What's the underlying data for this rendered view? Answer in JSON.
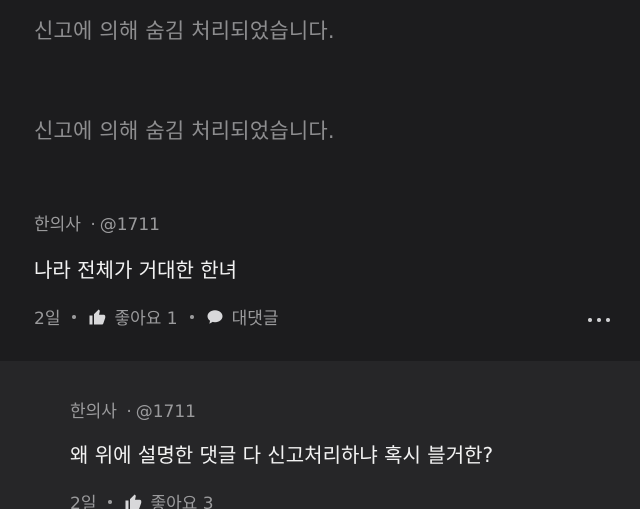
{
  "hidden_notices": [
    "신고에 의해 숨김 처리되었습니다.",
    "신고에 의해 숨김 처리되었습니다."
  ],
  "comment": {
    "author": "한의사",
    "separator": "·",
    "handle": "@1711",
    "text": "나라 전체가 거대한 한녀",
    "age": "2일",
    "like_label": "좋아요 1",
    "reply_label": "대댓글"
  },
  "reply": {
    "author": "한의사",
    "separator": "·",
    "handle": "@1711",
    "text": "왜 위에 설명한 댓글 다 신고처리하냐 혹시 블거한?",
    "age": "2일",
    "like_label": "좋아요 3"
  },
  "icons": {
    "like": "thumbs-up-icon",
    "reply": "speech-bubble-icon",
    "more": "more-horizontal-icon"
  }
}
